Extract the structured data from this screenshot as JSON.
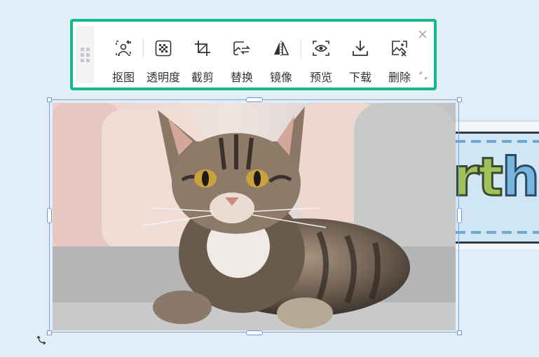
{
  "toolbar": {
    "tools": [
      {
        "label": "抠图",
        "icon": "cutout-icon"
      },
      {
        "label": "透明度",
        "icon": "transparency-icon"
      },
      {
        "label": "截剪",
        "icon": "crop-icon"
      },
      {
        "label": "替换",
        "icon": "replace-icon"
      },
      {
        "label": "镜像",
        "icon": "mirror-icon"
      },
      {
        "label": "预览",
        "icon": "preview-icon"
      },
      {
        "label": "下载",
        "icon": "download-icon"
      },
      {
        "label": "删除",
        "icon": "delete-image-icon"
      }
    ],
    "accent_color": "#12b886"
  },
  "canvas": {
    "background_color": "#e1eef8",
    "selection_color": "#6f95e3",
    "banner_text": "rth",
    "banner_text_highlight": "h"
  }
}
